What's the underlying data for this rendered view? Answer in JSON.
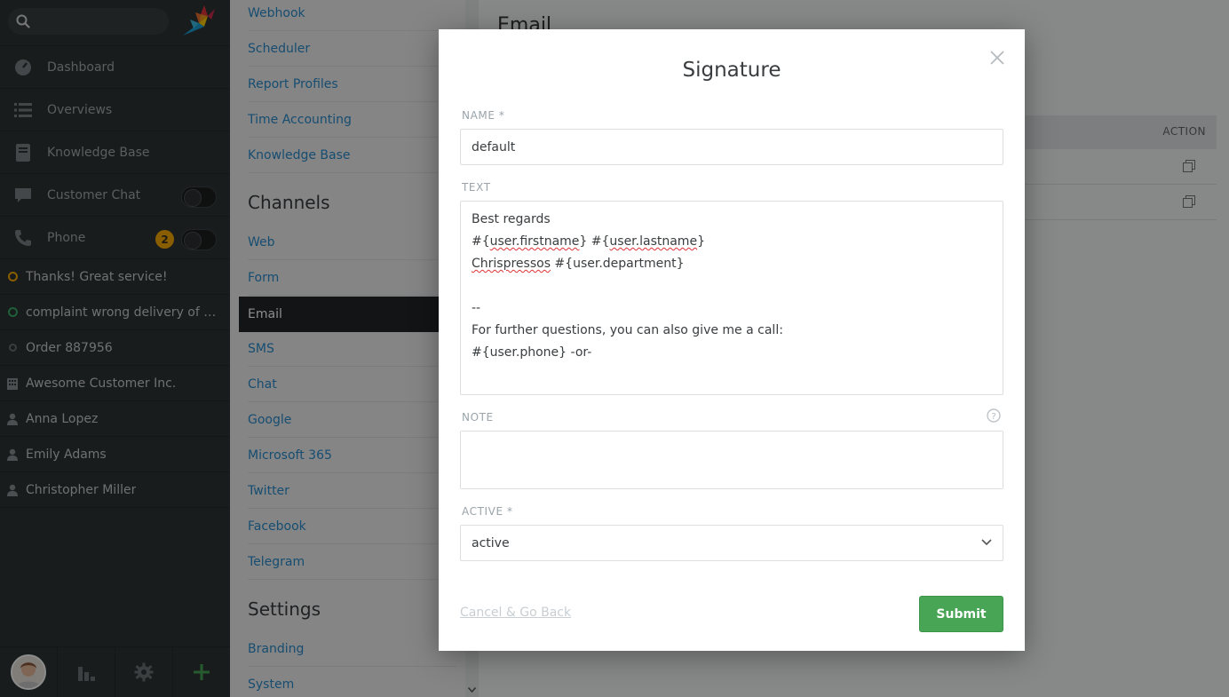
{
  "sidebar": {
    "search": {
      "value": "",
      "placeholder": ""
    },
    "nav": [
      {
        "label": "Dashboard",
        "icon": "dashboard-icon"
      },
      {
        "label": "Overviews",
        "icon": "list-icon"
      },
      {
        "label": "Knowledge Base",
        "icon": "book-icon"
      },
      {
        "label": "Customer Chat",
        "icon": "chat-icon",
        "toggle": "off"
      },
      {
        "label": "Phone",
        "icon": "phone-icon",
        "toggle": "off",
        "badge": "2"
      }
    ],
    "tasks": [
      {
        "label": "Thanks! Great service!",
        "type": "ticket",
        "status_color": "#faab00"
      },
      {
        "label": "complaint wrong delivery of ord...",
        "type": "ticket",
        "status_color": "#38ad69"
      },
      {
        "label": "Order 887956",
        "type": "ticket",
        "status_color": "#6b7174"
      },
      {
        "label": "Awesome Customer Inc.",
        "type": "organization"
      },
      {
        "label": "Anna Lopez",
        "type": "user"
      },
      {
        "label": "Emily Adams",
        "type": "user"
      },
      {
        "label": "Christopher Miller",
        "type": "user"
      }
    ],
    "bottom_icons": [
      "avatar",
      "stats-icon",
      "gear-icon",
      "plus-icon"
    ]
  },
  "settings_nav": {
    "top_links": [
      "Webhook",
      "Scheduler",
      "Report Profiles",
      "Time Accounting",
      "Knowledge Base"
    ],
    "channels_heading": "Channels",
    "channels": [
      "Web",
      "Form",
      "Email",
      "SMS",
      "Chat",
      "Google",
      "Microsoft 365",
      "Twitter",
      "Facebook",
      "Telegram"
    ],
    "active_channel": "Email",
    "settings_heading": "Settings",
    "settings": [
      "Branding",
      "System"
    ]
  },
  "main": {
    "title": "Email",
    "action_header": "ACTION"
  },
  "modal": {
    "title": "Signature",
    "name_label": "NAME *",
    "name_value": "default",
    "text_label": "TEXT",
    "text_lines": [
      "Best regards",
      "#{user.firstname} #{user.lastname}",
      "Chrispressos #{user.department}",
      "",
      "--",
      "For further questions, you can also give me a call:",
      "#{user.phone} -or-"
    ],
    "note_label": "NOTE",
    "note_value": "",
    "active_label": "ACTIVE *",
    "active_value": "active",
    "cancel_label": "Cancel & Go Back",
    "submit_label": "Submit"
  },
  "colors": {
    "accent_blue": "#2a8ccc",
    "submit_green": "#49a556",
    "badge_yellow": "#faab00"
  }
}
